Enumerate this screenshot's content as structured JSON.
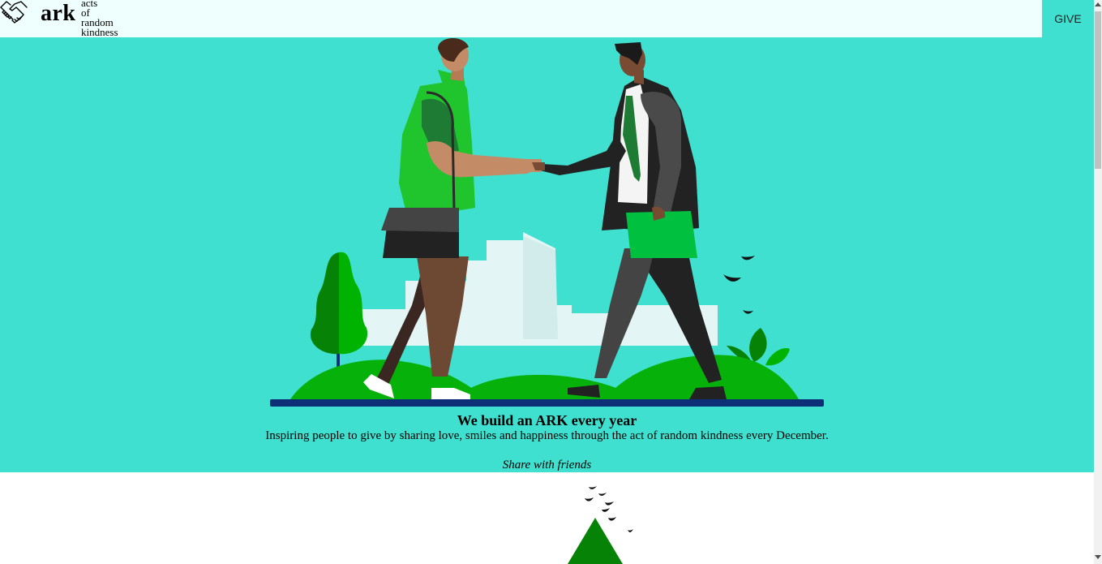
{
  "header": {
    "brand": "ark",
    "tagline": [
      "acts",
      "of",
      "random",
      "kindness"
    ],
    "logo_icon": "handshake-icon",
    "give_label": "GIVE"
  },
  "hero": {
    "title": "We build an ARK every year",
    "subtitle": "Inspiring people to give by sharing love, smiles and happiness through the act of random kindness every December.",
    "share_label": "Share with friends",
    "illustration": "two-people-handshake-illustration"
  },
  "colors": {
    "hero_background": "#40e0d0",
    "header_background": "#effffd",
    "give_button": "#40e0d0",
    "grass_green": "#06b10a",
    "tree_dark_green": "#068306",
    "ground_navy": "#0d2f78"
  }
}
